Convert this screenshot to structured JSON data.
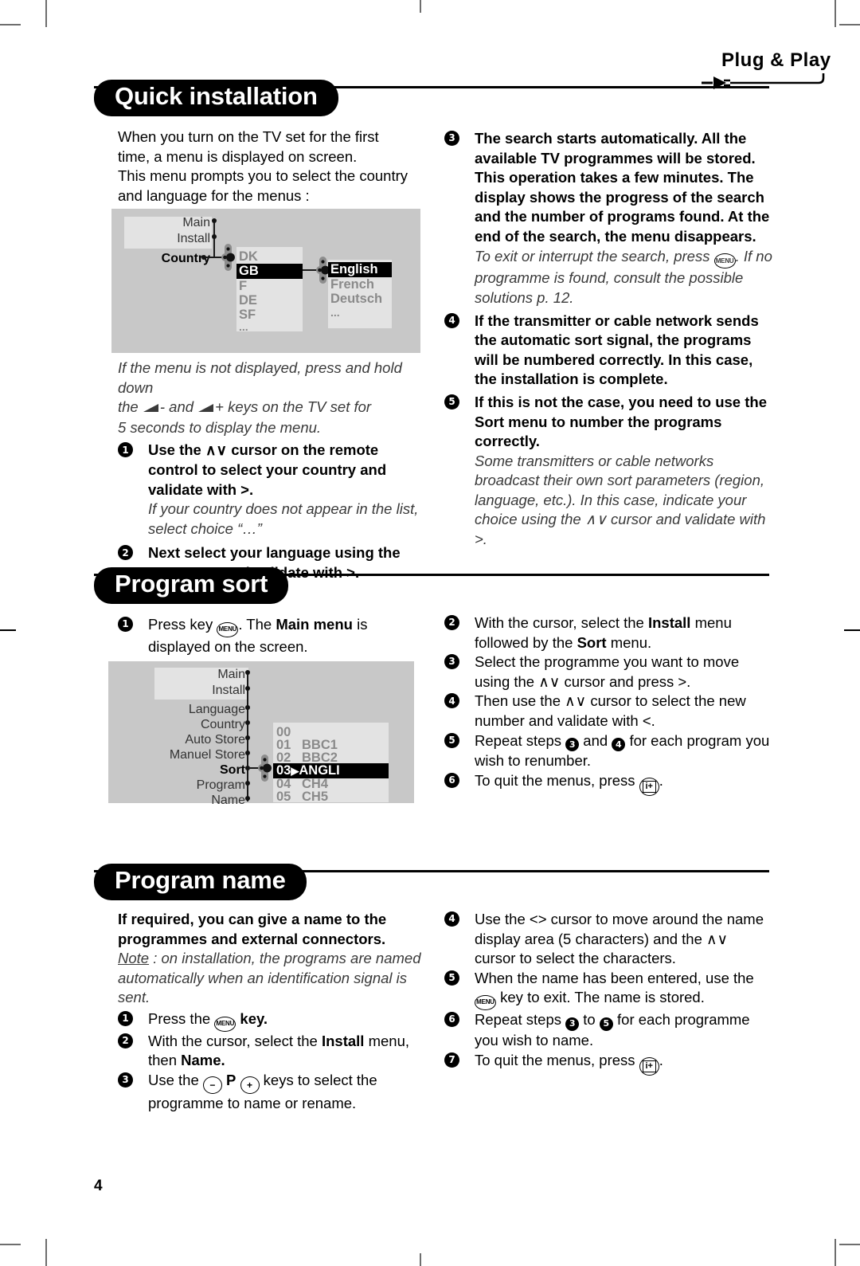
{
  "page": {
    "number": "4",
    "brand_logo": "Plug & Play"
  },
  "sections": [
    {
      "id": "quick-installation",
      "title": "Quick installation",
      "left": {
        "intro": [
          "When you turn on the TV set for the first",
          "time, a menu is displayed on screen.",
          "This menu prompts you to select the country",
          "and language for the menus :"
        ],
        "note_after_diagram": [
          "If the menu is not displayed, press and hold down",
          "the ⬟- and ⬟+ keys on the TV set for",
          "5 seconds to display the menu."
        ],
        "steps": [
          {
            "n": "1",
            "bold": "Use the ∧∨ cursor on the remote control to select your country and validate with >.",
            "italic": "If your country does not appear in the list, select choice “…”"
          },
          {
            "n": "2",
            "bold": "Next select your language using the ∧∨ cursor and validate with >.",
            "italic": ""
          }
        ]
      },
      "right": {
        "steps": [
          {
            "n": "3",
            "bold": "The search starts automatically. All the available TV programmes will be stored. This operation takes a few minutes. The display shows the progress of the search and the number of programs found. At the end of the search, the menu disappears.",
            "italic_a": "To exit or interrupt the search, press",
            "italic_key": "MENU",
            "italic_b": ". If no programme is found, consult the possible solutions p. 12."
          },
          {
            "n": "4",
            "bold": "If the transmitter or cable network sends the automatic sort signal, the programs will be numbered correctly. In this case, the installation is complete.",
            "italic": ""
          },
          {
            "n": "5",
            "bold_a": "If this is not the case, you need to use the ",
            "bold_strong": "Sort",
            "bold_b": " menu to number the programs correctly.",
            "italic": "Some transmitters or cable networks broadcast their own sort parameters (region, language, etc.). In this case, indicate your choice using the ∧∨ cursor and validate with >."
          }
        ]
      },
      "diagram": {
        "name": "country-language-menu",
        "rows": [
          {
            "label": "Main",
            "bold": false
          },
          {
            "label": "Install",
            "bold": false
          },
          {
            "label": "Country",
            "bold": true
          }
        ],
        "list1": {
          "items": [
            "DK",
            "GB",
            "F",
            "DE",
            "SF",
            "..."
          ],
          "selected": "GB"
        },
        "list2": {
          "items": [
            "English",
            "French",
            "Deutsch",
            "..."
          ],
          "selected": "English"
        }
      }
    },
    {
      "id": "program-sort",
      "title": "Program sort",
      "left": {
        "steps": [
          {
            "n": "1",
            "a": "Press key ",
            "key": "MENU",
            "b": ". The ",
            "strong": "Main menu",
            "c": " is displayed on the screen."
          }
        ]
      },
      "right": {
        "steps": [
          {
            "n": "2",
            "a": "With the cursor, select the ",
            "strong": "Install",
            "b": " menu followed by the ",
            "strong2": "Sort",
            "c": " menu."
          },
          {
            "n": "3",
            "text": "Select the programme you want to move using the ∧∨ cursor and press >."
          },
          {
            "n": "4",
            "text": "Then use the ∧∨ cursor to select the new number and validate with <."
          },
          {
            "n": "5",
            "a": "Repeat steps ",
            "ref1": "3",
            "b": " and ",
            "ref2": "4",
            "c": " for each program you wish to renumber."
          },
          {
            "n": "6",
            "a": "To quit the menus, press ",
            "key": "i+",
            "b": "."
          }
        ]
      },
      "diagram": {
        "name": "sort-menu",
        "rows": [
          {
            "label": "Main",
            "bold": false
          },
          {
            "label": "Install",
            "bold": false
          },
          {
            "label": "Language",
            "bold": false
          },
          {
            "label": "Country",
            "bold": false
          },
          {
            "label": "Auto Store",
            "bold": false
          },
          {
            "label": "Manuel Store",
            "bold": false
          },
          {
            "label": "Sort",
            "bold": true
          },
          {
            "label": "Program",
            "bold": false
          },
          {
            "label": "Name",
            "bold": false
          }
        ],
        "list": {
          "items": [
            {
              "num": "00",
              "name": ""
            },
            {
              "num": "01",
              "name": "BBC1"
            },
            {
              "num": "02",
              "name": "BBC2"
            },
            {
              "num": "03",
              "name": "ANGLI",
              "selected": true
            },
            {
              "num": "04",
              "name": "CH4"
            },
            {
              "num": "05",
              "name": "CH5"
            }
          ]
        }
      }
    },
    {
      "id": "program-name",
      "title": "Program name",
      "left": {
        "intro_bold": "If required, you can give a name to the programmes and external connectors.",
        "note_label": "Note",
        "note_text": " : on installation, the programs are named automatically when an identification signal is sent.",
        "steps": [
          {
            "n": "1",
            "a": "Press the ",
            "key": "MENU",
            "b": " key."
          },
          {
            "n": "2",
            "a": "With the cursor, select the ",
            "strong": "Install",
            "b": " menu, then ",
            "strong2": "Name."
          },
          {
            "n": "3",
            "a": "Use the ",
            "minus": "−",
            "p": "P",
            "plus": "+",
            "b": " keys to select the programme to name or rename."
          }
        ]
      },
      "right": {
        "steps": [
          {
            "n": "4",
            "text": "Use the <> cursor to move around the name display area (5 characters) and the ∧∨ cursor to select the characters."
          },
          {
            "n": "5",
            "a": "When the name has been entered, use the ",
            "key": "MENU",
            "b": " key to exit. The name is stored."
          },
          {
            "n": "6",
            "a": "Repeat steps ",
            "ref1": "3",
            "b": " to ",
            "ref2": "5",
            "c": " for each programme you wish to name."
          },
          {
            "n": "7",
            "a": "To quit the menus, press ",
            "key": "i+",
            "b": "."
          }
        ]
      }
    }
  ]
}
